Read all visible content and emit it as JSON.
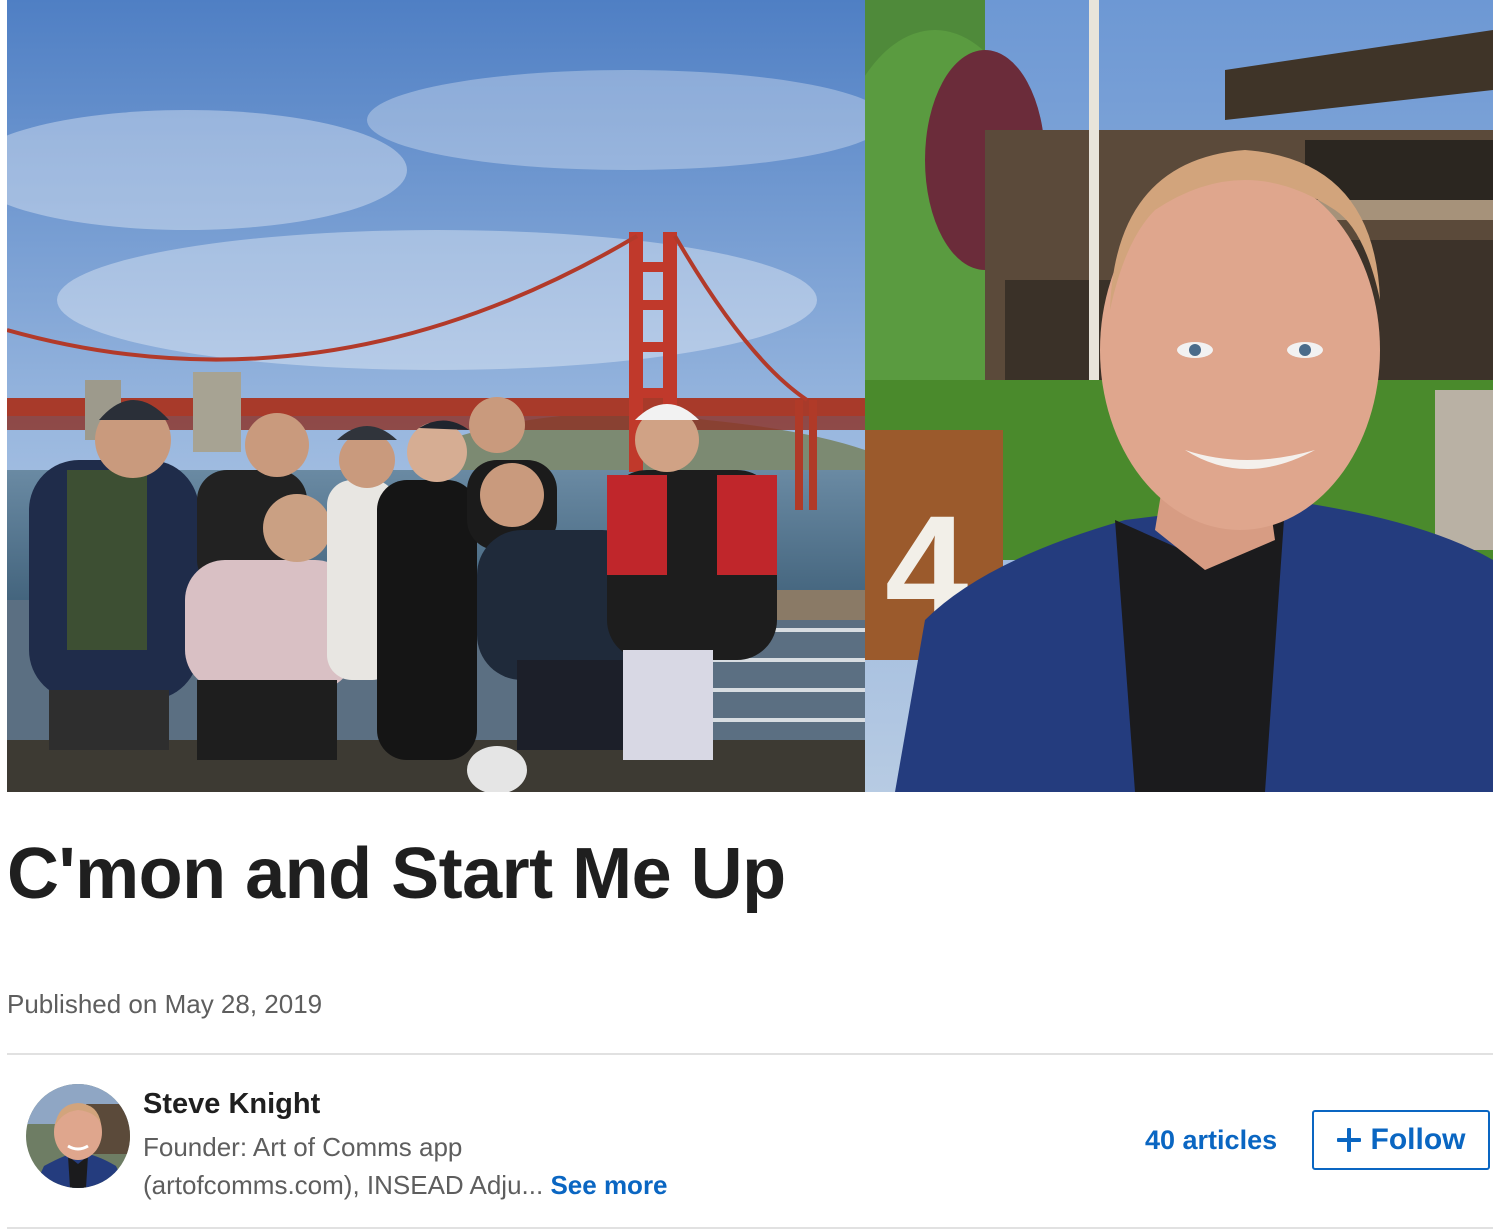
{
  "article": {
    "title": "C'mon and Start Me Up",
    "published_prefix": "Published on",
    "published_date": "May 28, 2019"
  },
  "author": {
    "name": "Steve Knight",
    "headline_line1": "Founder: Art of Comms app",
    "headline_line2": "(artofcomms.com), INSEAD Adju...",
    "see_more": "See more",
    "articles_count": "40 articles",
    "follow_label": "Follow"
  },
  "hero": {
    "left_photo_alt": "group-photo-golden-gate-bridge",
    "right_photo_alt": "selfie-portrait-building-number-4",
    "sign_number": "4"
  },
  "colors": {
    "accent": "#0a66c2",
    "title_text": "#1f1f1f",
    "secondary_text": "#5e5e5e",
    "divider": "#e1e1e1",
    "bridge_red": "#c0392b",
    "sky_blue": "#7fa6d6"
  },
  "icons": {
    "follow": "plus-icon"
  }
}
